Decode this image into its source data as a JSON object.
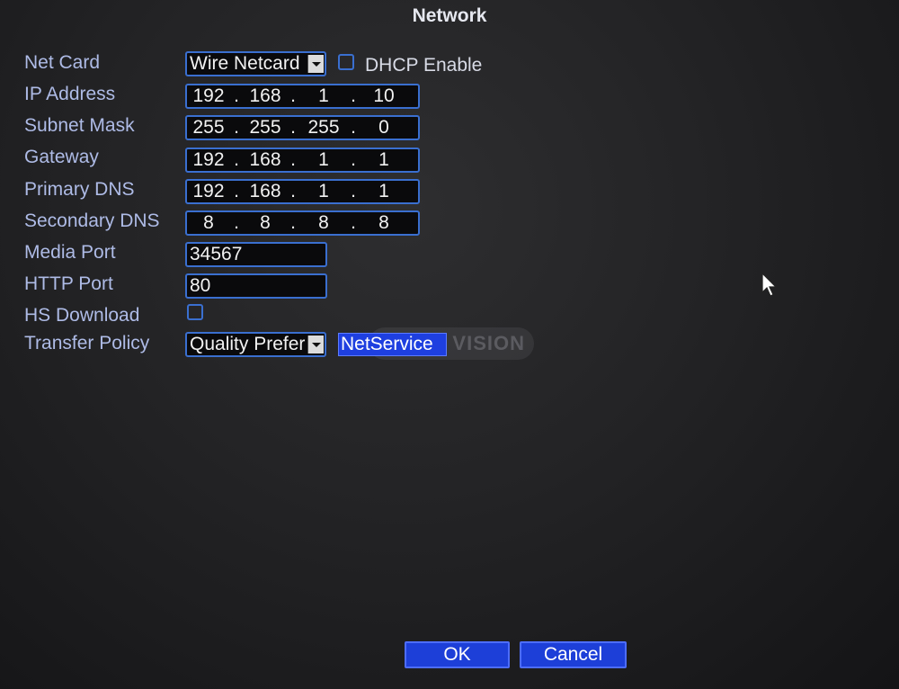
{
  "window": {
    "title": "Network"
  },
  "fields": {
    "net_card": {
      "label": "Net Card",
      "value": "Wire Netcard"
    },
    "dhcp": {
      "label": "DHCP Enable",
      "checked": false
    },
    "ip_address": {
      "label": "IP Address",
      "octets": [
        "192",
        "168",
        "1",
        "10"
      ]
    },
    "subnet_mask": {
      "label": "Subnet Mask",
      "octets": [
        "255",
        "255",
        "255",
        "0"
      ]
    },
    "gateway": {
      "label": "Gateway",
      "octets": [
        "192",
        "168",
        "1",
        "1"
      ]
    },
    "primary_dns": {
      "label": "Primary DNS",
      "octets": [
        "192",
        "168",
        "1",
        "1"
      ]
    },
    "secondary_dns": {
      "label": "Secondary DNS",
      "octets": [
        "8",
        "8",
        "8",
        "8"
      ]
    },
    "media_port": {
      "label": "Media Port",
      "value": "34567"
    },
    "http_port": {
      "label": "HTTP Port",
      "value": "80"
    },
    "hs_download": {
      "label": "HS Download",
      "checked": false
    },
    "transfer_policy": {
      "label": "Transfer Policy",
      "value": "Quality Prefer"
    }
  },
  "netservice_button": {
    "label": "NetService"
  },
  "watermark": {
    "text": "VISION"
  },
  "buttons": {
    "ok": "OK",
    "cancel": "Cancel"
  },
  "colors": {
    "field_border": "#3a6fd0",
    "button_bg": "#1d3fd8",
    "label": "#aebbe6"
  }
}
